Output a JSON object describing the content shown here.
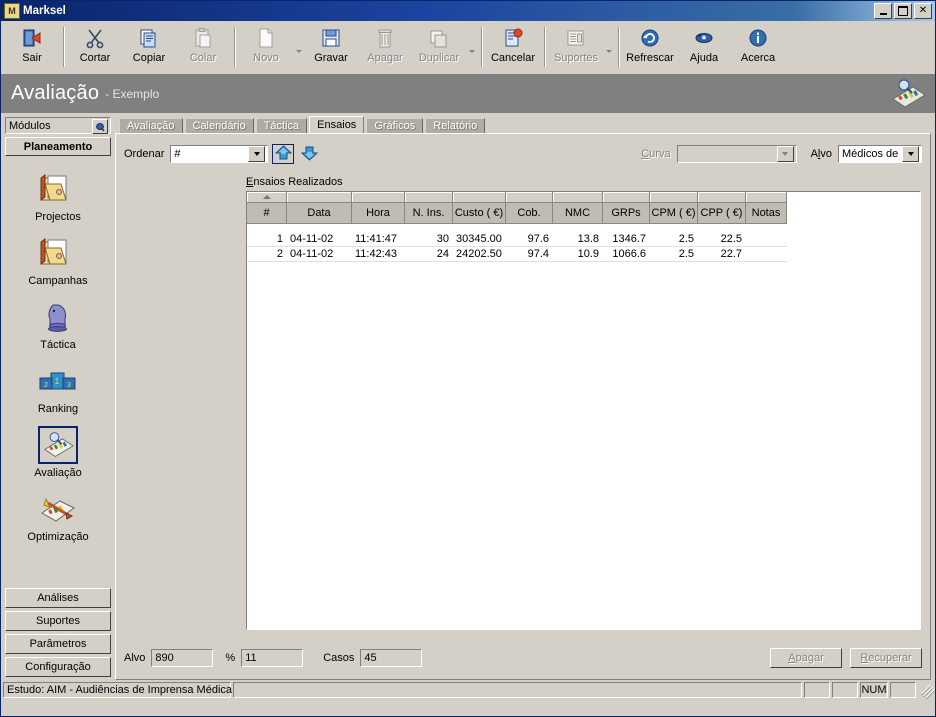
{
  "window": {
    "title": "Marksel",
    "icon": "app-icon",
    "minimize_label": "Minimizar",
    "maximize_label": "Maximizar",
    "close_label": "Fechar"
  },
  "toolbar": {
    "items": [
      {
        "label": "Sair",
        "icon": "exit-door-icon",
        "enabled": true,
        "dropdown": false
      },
      {
        "label": "Cortar",
        "icon": "scissors-icon",
        "enabled": true,
        "dropdown": false
      },
      {
        "label": "Copiar",
        "icon": "copy-pages-icon",
        "enabled": true,
        "dropdown": false
      },
      {
        "label": "Colar",
        "icon": "clipboard-icon",
        "enabled": false,
        "dropdown": false
      },
      {
        "label": "Novo",
        "icon": "new-document-icon",
        "enabled": false,
        "dropdown": true
      },
      {
        "label": "Gravar",
        "icon": "save-disk-icon",
        "enabled": true,
        "dropdown": false
      },
      {
        "label": "Apagar",
        "icon": "trash-icon",
        "enabled": false,
        "dropdown": false
      },
      {
        "label": "Duplicar",
        "icon": "duplicate-icon",
        "enabled": false,
        "dropdown": true
      },
      {
        "label": "Cancelar",
        "icon": "cancel-doc-icon",
        "enabled": true,
        "dropdown": false
      },
      {
        "label": "Suportes",
        "icon": "media-list-icon",
        "enabled": false,
        "dropdown": true
      },
      {
        "label": "Refrescar",
        "icon": "refresh-icon",
        "enabled": true,
        "dropdown": false
      },
      {
        "label": "Ajuda",
        "icon": "help-arrow-icon",
        "enabled": true,
        "dropdown": false
      },
      {
        "label": "Acerca",
        "icon": "info-icon",
        "enabled": true,
        "dropdown": false
      }
    ]
  },
  "header": {
    "title": "Avaliação",
    "subtitle": "- Exemplo",
    "icon": "evaluation-icon"
  },
  "sidebar": {
    "modules_label": "Módulos",
    "modules_pin_icon": "pin-icon",
    "group_label": "Planeamento",
    "items": [
      {
        "label": "Projectos",
        "icon": "folders-icon",
        "selected": false
      },
      {
        "label": "Campanhas",
        "icon": "folders-icon",
        "selected": false
      },
      {
        "label": "Táctica",
        "icon": "chess-knight-icon",
        "selected": false
      },
      {
        "label": "Ranking",
        "icon": "podium-icon",
        "selected": false
      },
      {
        "label": "Avaliação",
        "icon": "evaluation-icon",
        "selected": true
      },
      {
        "label": "Optimização",
        "icon": "optimization-icon",
        "selected": false
      }
    ],
    "bottom_buttons": [
      {
        "label": "Análises"
      },
      {
        "label": "Suportes"
      },
      {
        "label": "Parâmetros"
      },
      {
        "label": "Configuração"
      }
    ]
  },
  "tabs": [
    {
      "label": "Avaliação",
      "active": false
    },
    {
      "label": "Calendário",
      "active": false
    },
    {
      "label": "Táctica",
      "active": false
    },
    {
      "label": "Ensaios",
      "active": true
    },
    {
      "label": "Gráficos",
      "active": false
    },
    {
      "label": "Relatório",
      "active": false
    }
  ],
  "controls": {
    "ordenar_label": "Ordenar",
    "ordenar_value": "#",
    "sort_asc_icon": "arrow-up-icon",
    "sort_desc_icon": "arrow-down-icon",
    "curva_label": "Curva",
    "curva_value": "",
    "curva_enabled": false,
    "alvo_label": "Alvo",
    "alvo_value": "Médicos de ..."
  },
  "grid": {
    "caption": "Ensaios Realizados",
    "sorted_column": "#",
    "columns": [
      {
        "key": "num",
        "label": "#",
        "width": 40,
        "align": "right"
      },
      {
        "key": "data",
        "label": "Data",
        "width": 65,
        "align": "left"
      },
      {
        "key": "hora",
        "label": "Hora",
        "width": 53,
        "align": "left"
      },
      {
        "key": "nins",
        "label": "N. Ins.",
        "width": 48,
        "align": "right"
      },
      {
        "key": "custo",
        "label": "Custo ( €)",
        "width": 53,
        "align": "left"
      },
      {
        "key": "cob",
        "label": "Cob.",
        "width": 47,
        "align": "right"
      },
      {
        "key": "nmc",
        "label": "NMC",
        "width": 50,
        "align": "right"
      },
      {
        "key": "grps",
        "label": "GRPs",
        "width": 47,
        "align": "right"
      },
      {
        "key": "cpm",
        "label": "CPM ( €)",
        "width": 48,
        "align": "right"
      },
      {
        "key": "cpp",
        "label": "CPP ( €)",
        "width": 48,
        "align": "right"
      },
      {
        "key": "notas",
        "label": "Notas",
        "width": 41,
        "align": "left"
      }
    ],
    "rows": [
      {
        "num": "1",
        "data": "04-11-02",
        "hora": "11:41:47",
        "nins": "30",
        "custo": "30345.00",
        "cob": "97.6",
        "nmc": "13.8",
        "grps": "1346.7",
        "cpm": "2.5",
        "cpp": "22.5",
        "notas": ""
      },
      {
        "num": "2",
        "data": "04-11-02",
        "hora": "11:42:43",
        "nins": "24",
        "custo": "24202.50",
        "cob": "97.4",
        "nmc": "10.9",
        "grps": "1066.6",
        "cpm": "2.5",
        "cpp": "22.7",
        "notas": ""
      }
    ]
  },
  "footer": {
    "alvo_label": "Alvo",
    "alvo_value": "890",
    "pct_label": "%",
    "pct_value": "11",
    "casos_label": "Casos",
    "casos_value": "45",
    "apagar_label": "Apagar",
    "apagar_enabled": false,
    "recuperar_label": "Recuperar",
    "recuperar_enabled": false
  },
  "statusbar": {
    "study": "Estudo: AIM - Audiências de Imprensa Médica",
    "message": "",
    "seg1": "",
    "seg2": "",
    "num_indicator": "NUM",
    "seg4": ""
  },
  "colors": {
    "title_start": "#0a246a",
    "title_end": "#a6caf0",
    "face": "#d4d0c8",
    "header_band": "#808080",
    "grid_header": "#bfbcb4",
    "accent": "#3a82c4"
  }
}
